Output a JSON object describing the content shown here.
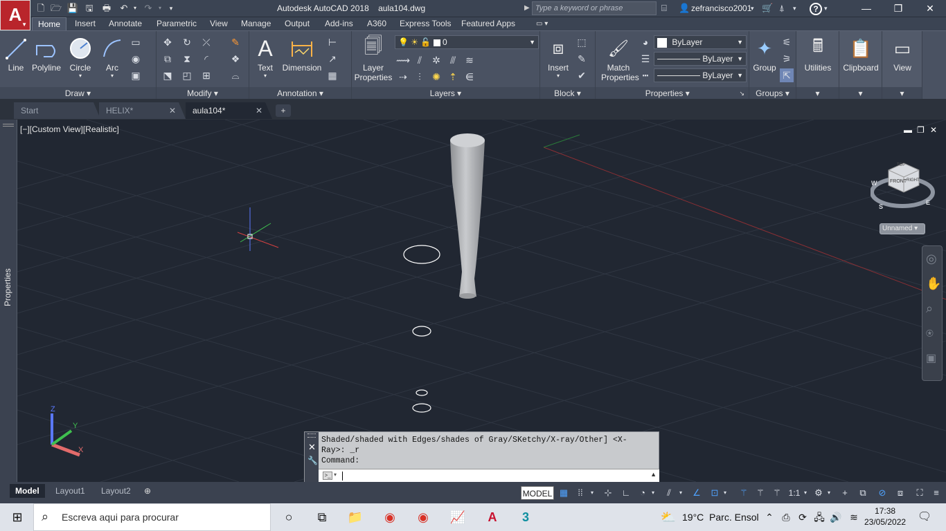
{
  "titlebar": {
    "app_letter": "A",
    "title": "Autodesk AutoCAD 2018    aula104.dwg",
    "search_placeholder": "Type a keyword or phrase",
    "user": "zefrancisco2001",
    "help": "?"
  },
  "ribbon_tabs": [
    "Home",
    "Insert",
    "Annotate",
    "Parametric",
    "View",
    "Manage",
    "Output",
    "Add-ins",
    "A360",
    "Express Tools",
    "Featured Apps"
  ],
  "ribbon": {
    "draw": {
      "title": "Draw",
      "line": "Line",
      "polyline": "Polyline",
      "circle": "Circle",
      "arc": "Arc"
    },
    "modify": {
      "title": "Modify"
    },
    "annotation": {
      "title": "Annotation",
      "text": "Text",
      "dimension": "Dimension"
    },
    "layers": {
      "title": "Layers",
      "layer_properties_1": "Layer",
      "layer_properties_2": "Properties",
      "current_layer": "0"
    },
    "block": {
      "title": "Block",
      "insert": "Insert"
    },
    "properties": {
      "title": "Properties",
      "match_1": "Match",
      "match_2": "Properties",
      "color": "ByLayer",
      "linetype": "ByLayer",
      "lineweight": "ByLayer"
    },
    "groups": {
      "title": "Groups",
      "group": "Group"
    },
    "utilities": "Utilities",
    "clipboard": "Clipboard",
    "view": "View"
  },
  "file_tabs": [
    {
      "label": "Start"
    },
    {
      "label": "HELIX*"
    },
    {
      "label": "aula104*"
    }
  ],
  "side_palette": "Properties",
  "viewport": {
    "label": "[−][Custom View][Realistic]",
    "viewcube_top": "TOP",
    "viewcube_front": "FRONT",
    "viewcube_right": "RIGHT",
    "compass_w": "W",
    "compass_s": "S",
    "compass_e": "E",
    "ucs_name": "Unnamed",
    "axis_z": "Z",
    "axis_y": "Y",
    "axis_x": "X"
  },
  "command": {
    "history": "Shaded/shaded with Edges/shades of Gray/SKetchy/X-ray/Other] <X-\nRay>: _r\nCommand:",
    "input": ""
  },
  "layout_tabs": [
    "Model",
    "Layout1",
    "Layout2"
  ],
  "status": {
    "model": "MODEL",
    "scale": "1:1"
  },
  "taskbar": {
    "search_placeholder": "Escreva aqui para procurar",
    "weather": "19°C  Parc. Ensol",
    "time": "17:38",
    "date": "23/05/2022"
  }
}
